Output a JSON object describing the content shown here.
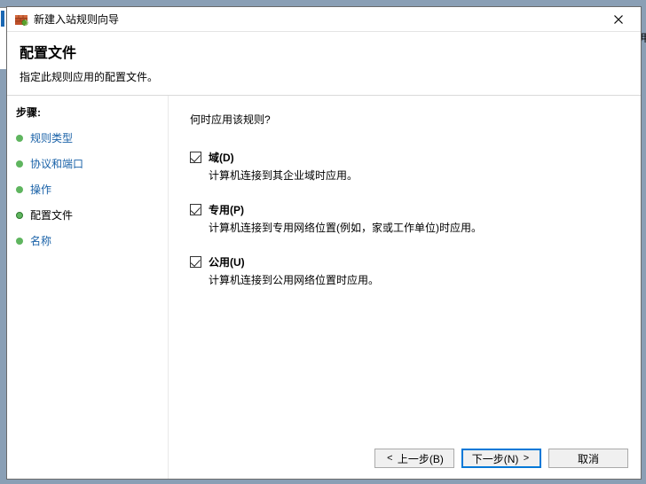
{
  "window": {
    "title": "新建入站规则向导"
  },
  "header": {
    "title": "配置文件",
    "subtitle": "指定此规则应用的配置文件。"
  },
  "sidebar": {
    "heading": "步骤:",
    "steps": [
      {
        "label": "规则类型"
      },
      {
        "label": "协议和端口"
      },
      {
        "label": "操作"
      },
      {
        "label": "配置文件"
      },
      {
        "label": "名称"
      }
    ]
  },
  "content": {
    "prompt": "何时应用该规则?",
    "options": [
      {
        "label": "域(D)",
        "desc": "计算机连接到其企业域时应用。",
        "checked": true
      },
      {
        "label": "专用(P)",
        "desc": "计算机连接到专用网络位置(例如，家或工作单位)时应用。",
        "checked": true
      },
      {
        "label": "公用(U)",
        "desc": "计算机连接到公用网络位置时应用。",
        "checked": true
      }
    ]
  },
  "footer": {
    "back": "上一步(B)",
    "next": "下一步(N)",
    "cancel": "取消"
  }
}
